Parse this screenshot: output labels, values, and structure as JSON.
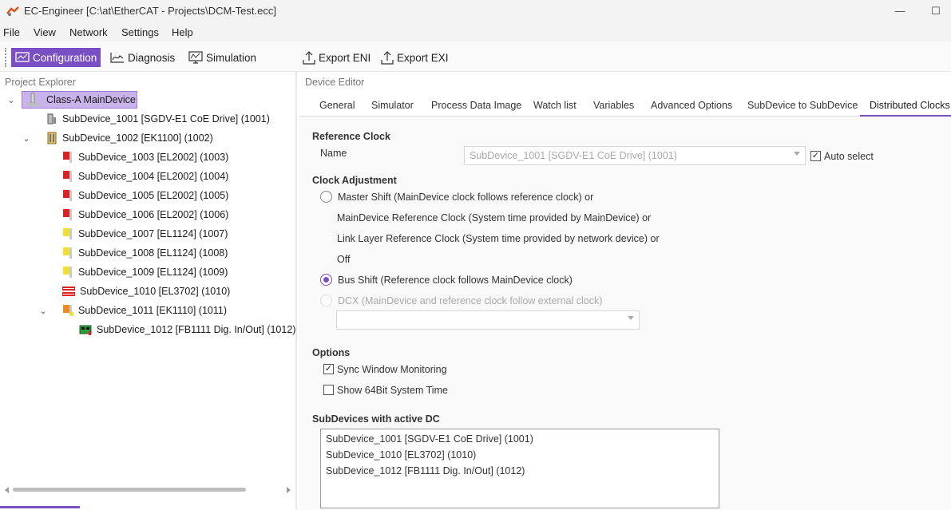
{
  "window": {
    "title": "EC-Engineer [C:\\at\\EtherCAT - Projects\\DCM-Test.ecc]",
    "min_glyph": "—",
    "max_glyph": "☐"
  },
  "menu": [
    "File",
    "View",
    "Network",
    "Settings",
    "Help"
  ],
  "toolbar": {
    "configuration": "Configuration",
    "diagnosis": "Diagnosis",
    "simulation": "Simulation",
    "export_eni": "Export ENI",
    "export_exi": "Export EXI"
  },
  "project_explorer": {
    "title": "Project Explorer",
    "root": "Class-A MainDevice",
    "items": [
      {
        "label": "SubDevice_1001 [SGDV-E1 CoE Drive] (1001)",
        "icon": "drive-icon"
      },
      {
        "label": "SubDevice_1002 [EK1100] (1002)",
        "icon": "coupler-icon"
      },
      {
        "label": "SubDevice_1003 [EL2002] (1003)",
        "icon": "red-terminal-icon"
      },
      {
        "label": "SubDevice_1004 [EL2002] (1004)",
        "icon": "red-terminal-icon"
      },
      {
        "label": "SubDevice_1005 [EL2002] (1005)",
        "icon": "red-terminal-icon"
      },
      {
        "label": "SubDevice_1006 [EL2002] (1006)",
        "icon": "red-terminal-icon"
      },
      {
        "label": "SubDevice_1007 [EL1124] (1007)",
        "icon": "yellow-terminal-icon"
      },
      {
        "label": "SubDevice_1008 [EL1124] (1008)",
        "icon": "yellow-terminal-icon"
      },
      {
        "label": "SubDevice_1009 [EL1124] (1009)",
        "icon": "yellow-terminal-icon"
      },
      {
        "label": "SubDevice_1010 [EL3702] (1010)",
        "icon": "beckhoff-logo-icon"
      },
      {
        "label": "SubDevice_1011 [EK1110] (1011)",
        "icon": "orange-terminal-icon"
      },
      {
        "label": "SubDevice_1012 [FB1111 Dig. In/Out] (1012)",
        "icon": "board-icon"
      }
    ]
  },
  "device_editor": {
    "title": "Device Editor",
    "tabs": [
      "General",
      "Simulator",
      "Process Data Image",
      "Watch list",
      "Variables",
      "Advanced Options",
      "SubDevice to SubDevice",
      "Distributed Clocks"
    ],
    "active_tab": "Distributed Clocks"
  },
  "dc": {
    "reference_clock": {
      "heading": "Reference Clock",
      "name_label": "Name",
      "name_value": "SubDevice_1001 [SGDV-E1 CoE Drive] (1001)",
      "auto_select_label": "Auto select",
      "auto_select_checked": true
    },
    "clock_adjustment": {
      "heading": "Clock Adjustment",
      "master_shift": "Master Shift (MainDevice clock follows reference clock) or",
      "maindevice_ref": "MainDevice Reference Clock (System time provided by MainDevice) or",
      "link_layer_ref": "Link Layer Reference Clock (System time provided by network device) or",
      "off": "Off",
      "bus_shift": "Bus Shift (Reference clock follows MainDevice clock)",
      "dcx": "DCX (MainDevice and reference clock follow external clock)",
      "selected": "Bus Shift"
    },
    "options": {
      "heading": "Options",
      "sync_window": "Sync Window Monitoring",
      "sync_window_checked": true,
      "show_64bit": "Show 64Bit System Time",
      "show_64bit_checked": false
    },
    "active_dc": {
      "heading": "SubDevices with active DC",
      "items": [
        "SubDevice_1001 [SGDV-E1 CoE Drive] (1001)",
        "SubDevice_1010 [EL3702] (1010)",
        "SubDevice_1012 [FB1111 Dig. In/Out] (1012)"
      ]
    }
  },
  "colors": {
    "accent": "#7a4fc4",
    "selection": "#c8b3ea"
  }
}
